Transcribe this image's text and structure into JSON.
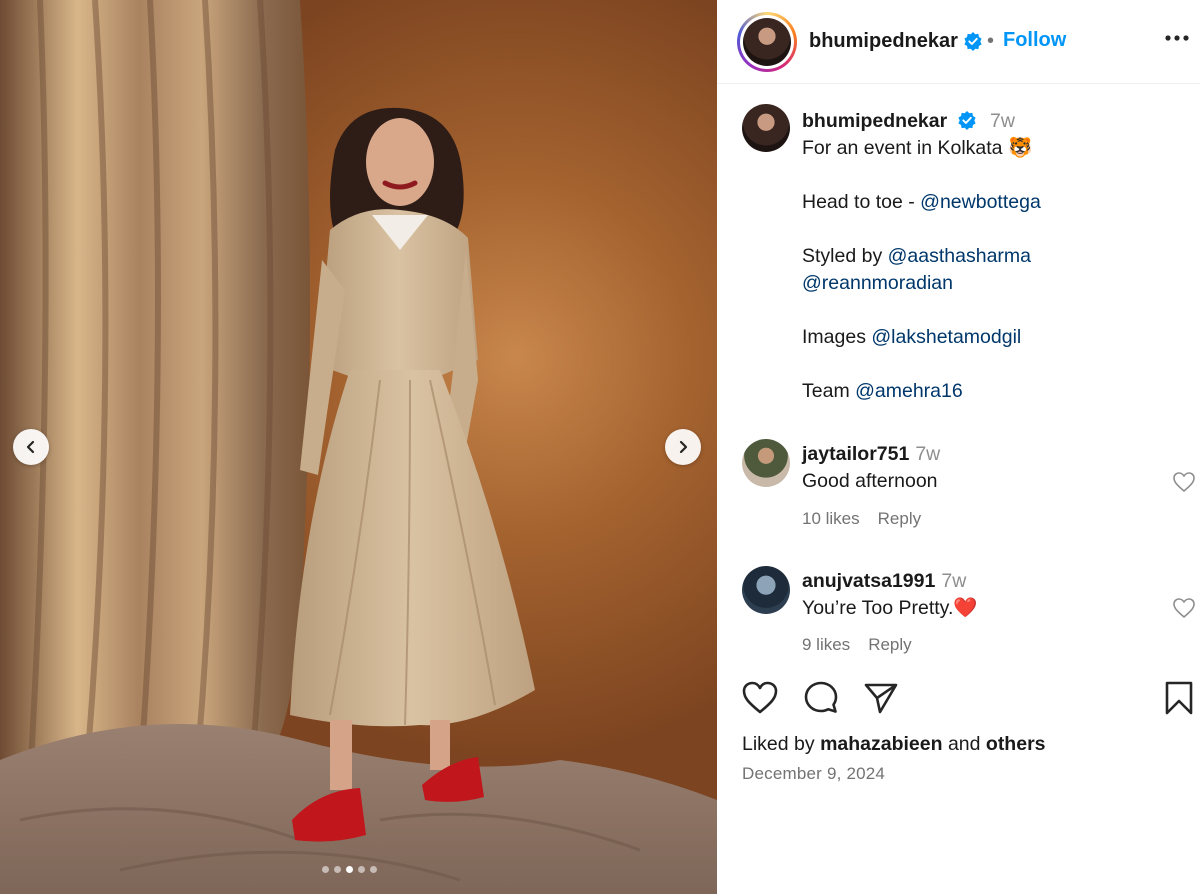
{
  "media": {
    "slide_count": 5,
    "active_slide": 3
  },
  "header": {
    "username": "bhumipednekar",
    "separator": "•",
    "follow_label": "Follow"
  },
  "caption": {
    "username": "bhumipednekar",
    "time": "7w",
    "line1": "For an event in Kolkata 🐯",
    "line2_prefix": "Head to toe - ",
    "line2_mention": "@newbottega",
    "line3_prefix": "Styled by ",
    "line3_mention": "@aasthasharma",
    "line4_mention": "@reannmoradian",
    "line5_prefix": "Images ",
    "line5_mention": "@lakshetamodgil",
    "line6_prefix": "Team ",
    "line6_mention": "@amehra16"
  },
  "comments": [
    {
      "username": "jaytailor751",
      "time": "7w",
      "text": "Good afternoon",
      "likes": "10 likes",
      "reply_label": "Reply"
    },
    {
      "username": "anujvatsa1991",
      "time": "7w",
      "text": "You’re Too Pretty.❤️",
      "likes": "9 likes",
      "reply_label": "Reply"
    }
  ],
  "liked_by": {
    "prefix": "Liked by ",
    "user": "mahazabieen",
    "and": " and ",
    "others": "others"
  },
  "post_date": "December 9, 2024",
  "colors": {
    "accent": "#0095f6",
    "mention": "#00376b",
    "muted": "#737373",
    "verified": "#0095f6"
  },
  "icons": {
    "prev": "chevron-left-icon",
    "next": "chevron-right-icon",
    "more": "more-horizontal-icon",
    "verified": "verified-badge-icon",
    "like": "heart-icon",
    "comment": "comment-bubble-icon",
    "share": "paper-plane-icon",
    "save": "bookmark-icon"
  }
}
